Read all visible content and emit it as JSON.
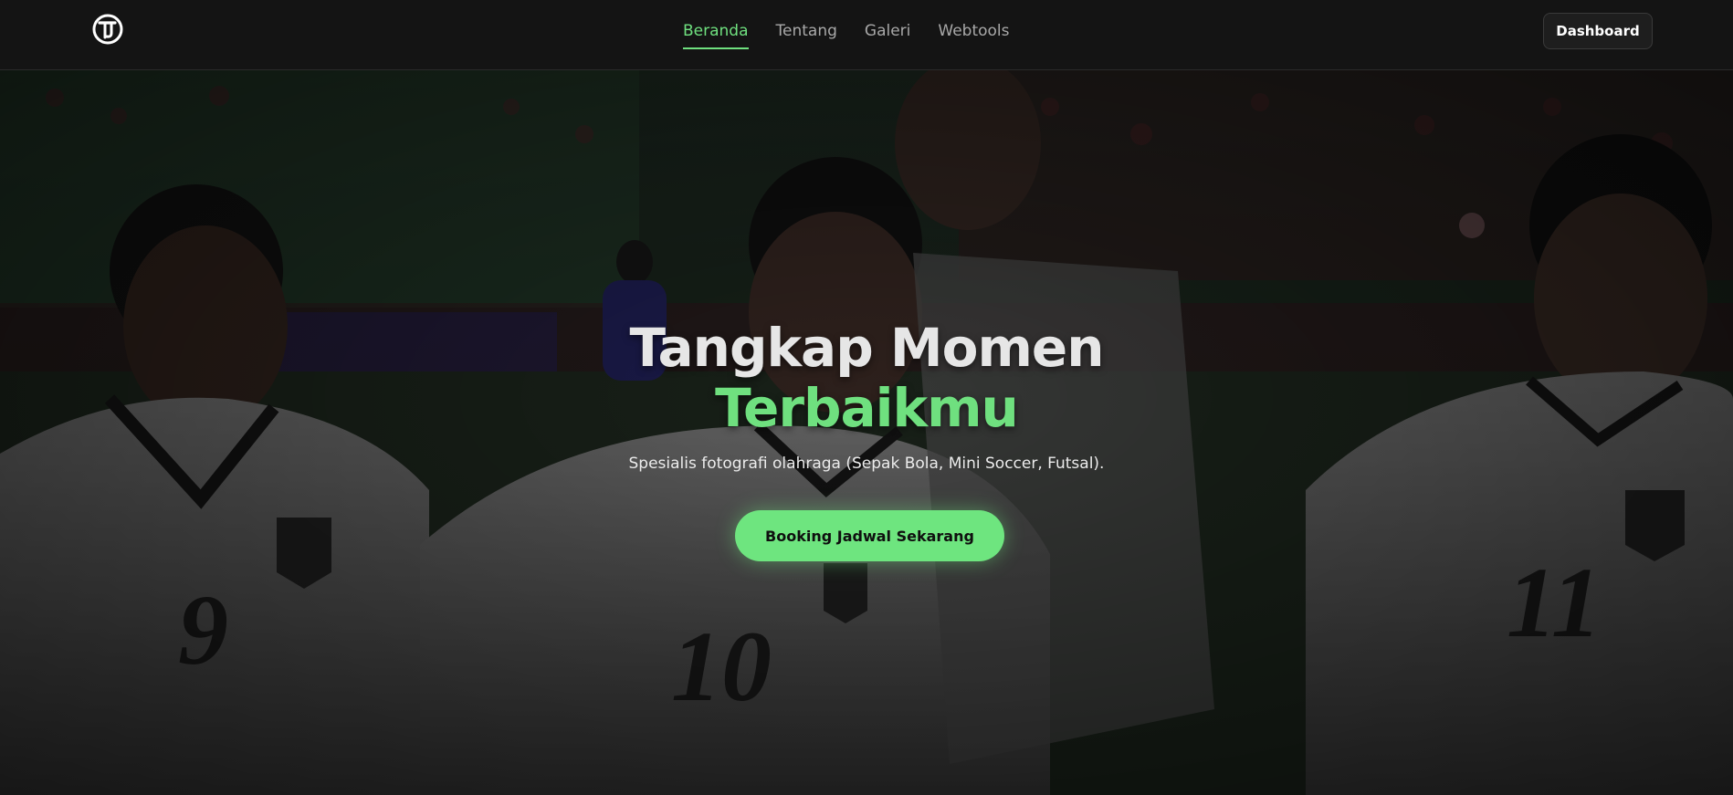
{
  "nav": {
    "links": [
      {
        "label": "Beranda",
        "active": true
      },
      {
        "label": "Tentang",
        "active": false
      },
      {
        "label": "Galeri",
        "active": false
      },
      {
        "label": "Webtools",
        "active": false
      }
    ],
    "dashboard_label": "Dashboard"
  },
  "hero": {
    "headline_line1": "Tangkap Momen",
    "headline_line2": "Terbaikmu",
    "subtitle": "Spesialis fotografi olahraga (Sepak Bola, Mini Soccer, Futsal).",
    "cta_label": "Booking Jadwal Sekarang"
  },
  "colors": {
    "accent": "#6fe07f",
    "nav_background": "#141414",
    "headline": "#e6e6e6"
  }
}
